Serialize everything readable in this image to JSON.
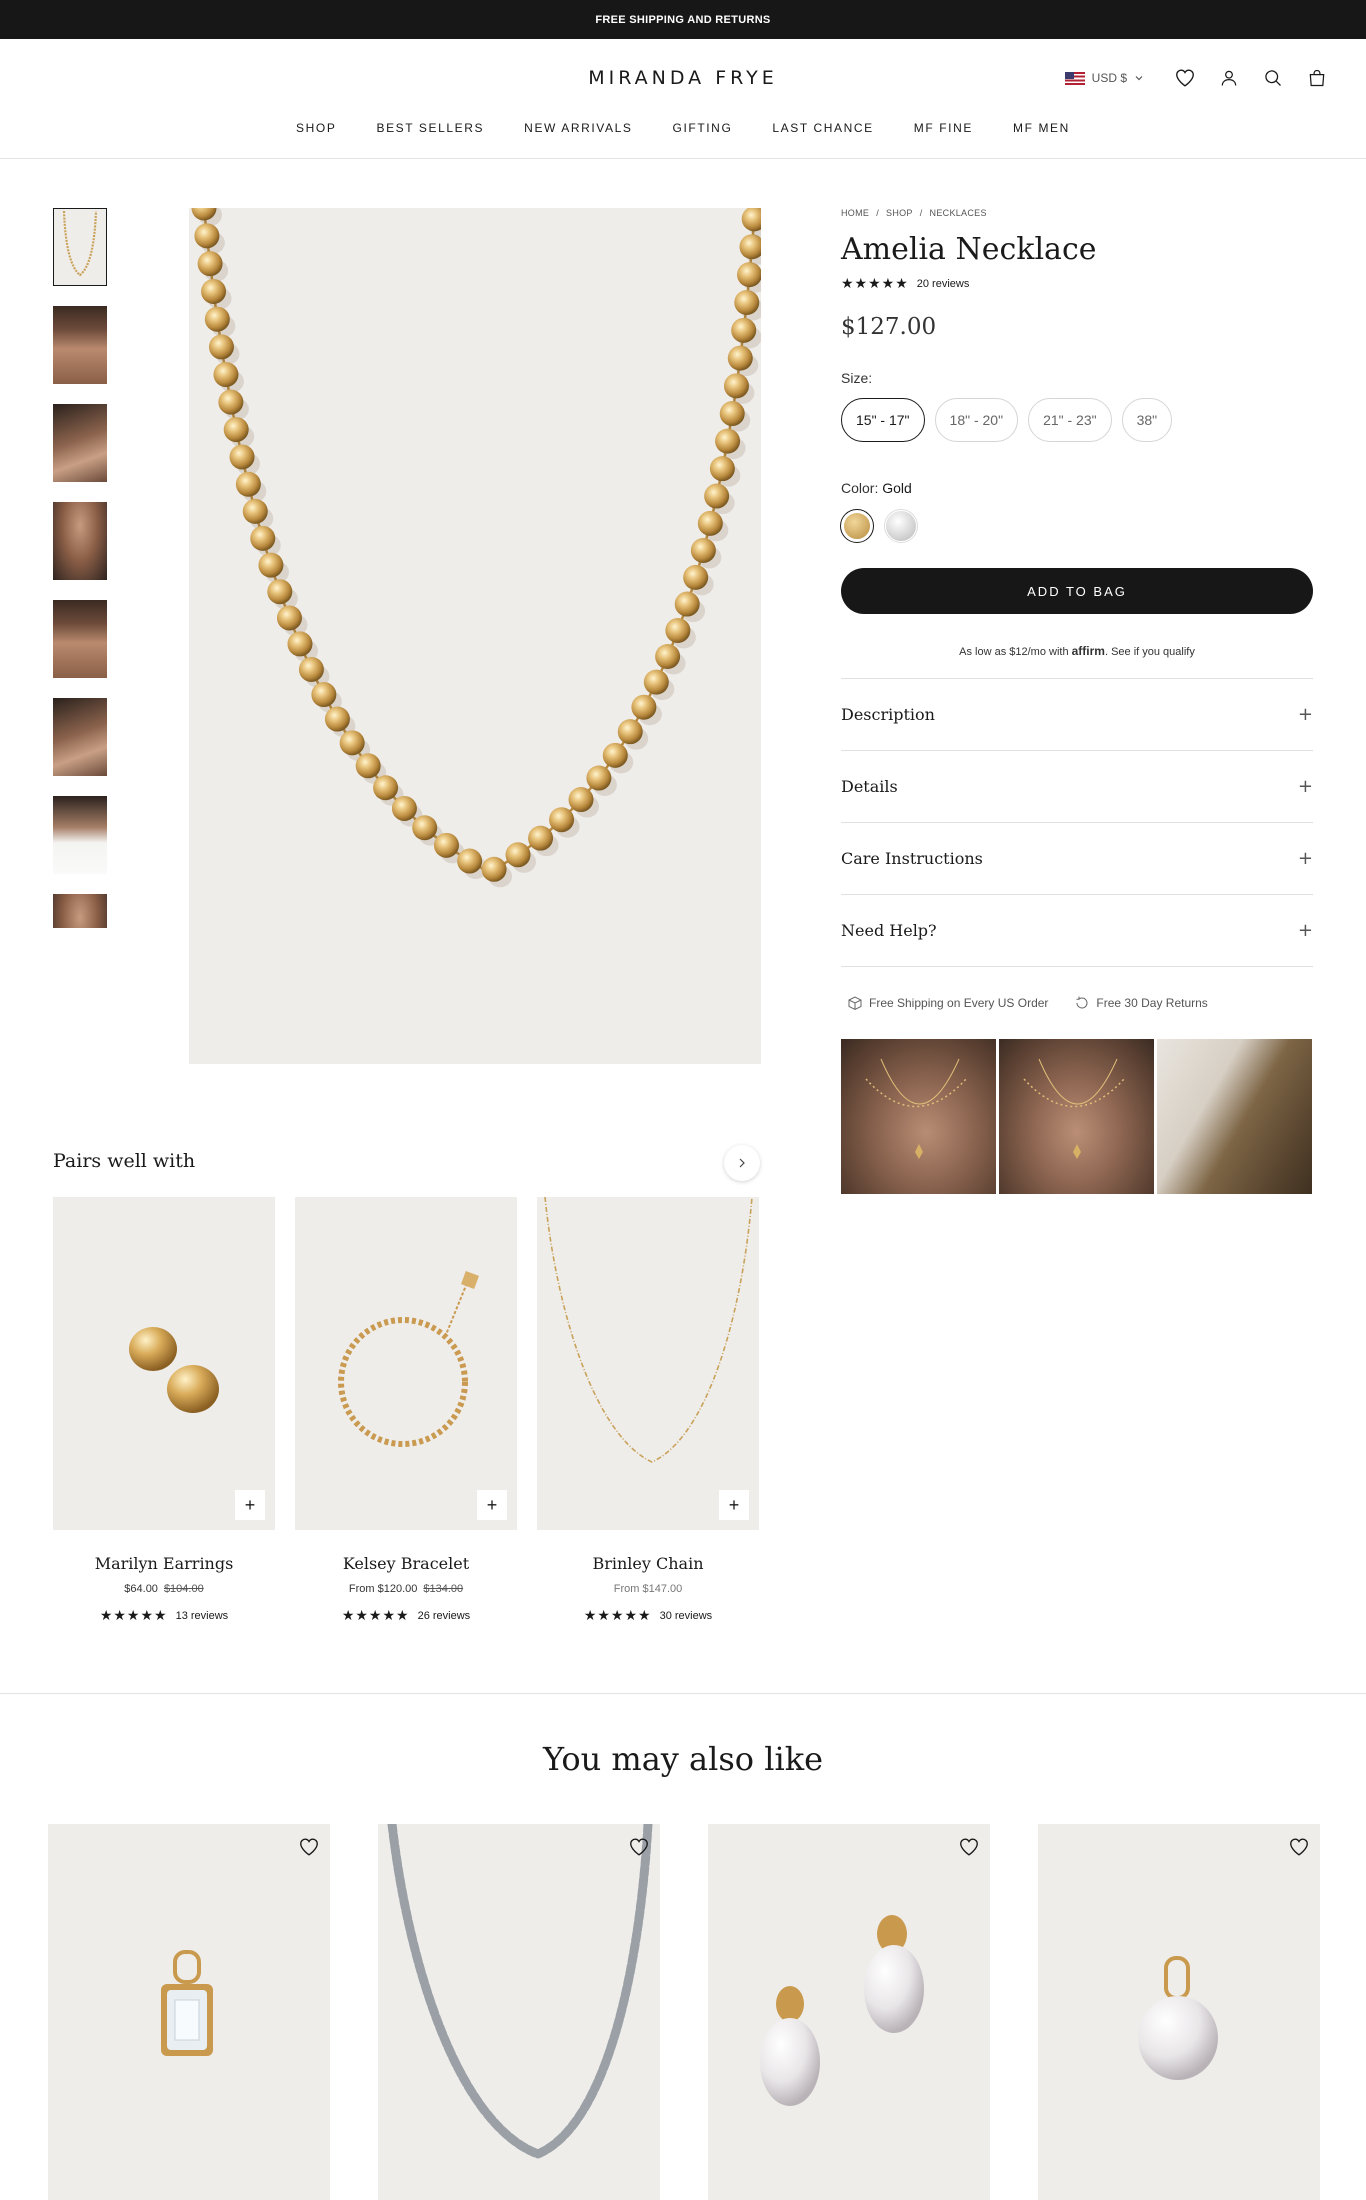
{
  "announcement": "FREE SHIPPING AND RETURNS",
  "header": {
    "logo": "MIRANDA FRYE",
    "currency": "USD $",
    "nav": [
      "SHOP",
      "BEST SELLERS",
      "NEW ARRIVALS",
      "GIFTING",
      "LAST CHANCE",
      "MF FINE",
      "MF MEN"
    ]
  },
  "product": {
    "breadcrumb": [
      "HOME",
      "SHOP",
      "NECKLACES"
    ],
    "breadcrumb_sep": "/",
    "title": "Amelia Necklace",
    "stars": "★★★★★",
    "reviews": "20 reviews",
    "price": "$127.00",
    "size_label": "Size:",
    "sizes": [
      "15\" - 17\"",
      "18\" - 20\"",
      "21\" - 23\"",
      "38\""
    ],
    "selected_size": "15\" - 17\"",
    "color_label": "Color:",
    "color_value": "Gold",
    "colors": [
      {
        "name": "Gold",
        "hex": "#d9b46c"
      },
      {
        "name": "Silver",
        "hex": "#e0e0e0"
      }
    ],
    "add_to_bag": "ADD TO BAG",
    "affirm": {
      "prefix": "As low as $12/mo with",
      "brand": "affirm",
      "suffix": ". See if you qualify"
    },
    "accordion": [
      "Description",
      "Details",
      "Care Instructions",
      "Need Help?"
    ],
    "accordion_icon": "+",
    "perks": [
      "Free Shipping on Every US Order",
      "Free 30 Day Returns"
    ]
  },
  "pairs": {
    "title": "Pairs well with",
    "add_icon": "+",
    "items": [
      {
        "name": "Marilyn Earrings",
        "price": "$64.00",
        "compare": "$104.00",
        "stars": "★★★★★",
        "reviews": "13 reviews"
      },
      {
        "name": "Kelsey Bracelet",
        "price": "From $120.00",
        "compare": "$134.00",
        "stars": "★★★★★",
        "reviews": "26 reviews"
      },
      {
        "name": "Brinley Chain",
        "price": "From $147.00",
        "compare": "",
        "stars": "★★★★★",
        "reviews": "30 reviews"
      }
    ]
  },
  "also_like": {
    "title": "You may also like"
  },
  "colors": {
    "dark": "#171717",
    "image_bg": "#efedea",
    "gold": "#d9b46c"
  }
}
